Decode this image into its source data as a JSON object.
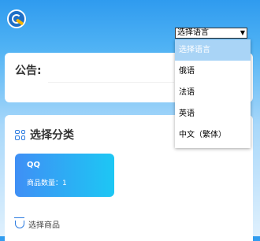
{
  "brand": {
    "logo_icon": "speedometer-logo-icon"
  },
  "language_select": {
    "value": "选择语言",
    "options": [
      "选择语言",
      "俄语",
      "法语",
      "英语",
      "中文（繁体）"
    ],
    "selected_index": 0
  },
  "notice": {
    "title": "公告:"
  },
  "category": {
    "title": "选择分类",
    "icon": "grid-icon",
    "cards": [
      {
        "name": "QQ",
        "count_label": "商品数量：1"
      }
    ]
  },
  "goods": {
    "label": "选择商品",
    "icon": "shopping-basket-icon"
  },
  "colors": {
    "accent": "#2f7de0",
    "header_blue": "#2f9bef",
    "card_gradient_start": "#3f8ff5",
    "card_gradient_end": "#1dc7f4",
    "selected_option": "#a9d4f6"
  }
}
